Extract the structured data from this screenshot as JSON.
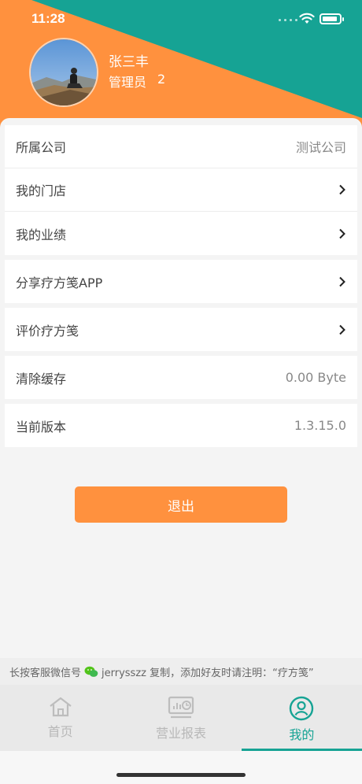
{
  "status": {
    "time": "11:28"
  },
  "colors": {
    "accent": "#16a394",
    "orange": "#ff913e"
  },
  "user": {
    "name": "张三丰",
    "role": "管理员",
    "count": "2"
  },
  "groups": [
    {
      "rows": [
        {
          "label": "所属公司",
          "value": "测试公司",
          "chevron": false
        },
        {
          "label": "我的门店",
          "value": "",
          "chevron": true
        },
        {
          "label": "我的业绩",
          "value": "",
          "chevron": true
        }
      ]
    },
    {
      "rows": [
        {
          "label": "分享疗方笺APP",
          "value": "",
          "chevron": true
        }
      ]
    },
    {
      "rows": [
        {
          "label": "评价疗方笺",
          "value": "",
          "chevron": true
        }
      ]
    },
    {
      "rows": [
        {
          "label": "清除缓存",
          "value": "0.00 Byte",
          "chevron": false
        }
      ]
    },
    {
      "rows": [
        {
          "label": "当前版本",
          "value": "1.3.15.0",
          "chevron": false
        }
      ]
    }
  ],
  "logout_label": "退出",
  "notice": {
    "prefix": "长按客服微信号",
    "suffix": "jerrysszz 复制，添加好友时请注明：“疗方笺”"
  },
  "tabs": [
    {
      "label": "首页",
      "icon": "home-icon"
    },
    {
      "label": "营业报表",
      "icon": "report-icon"
    },
    {
      "label": "我的",
      "icon": "user-icon"
    }
  ]
}
